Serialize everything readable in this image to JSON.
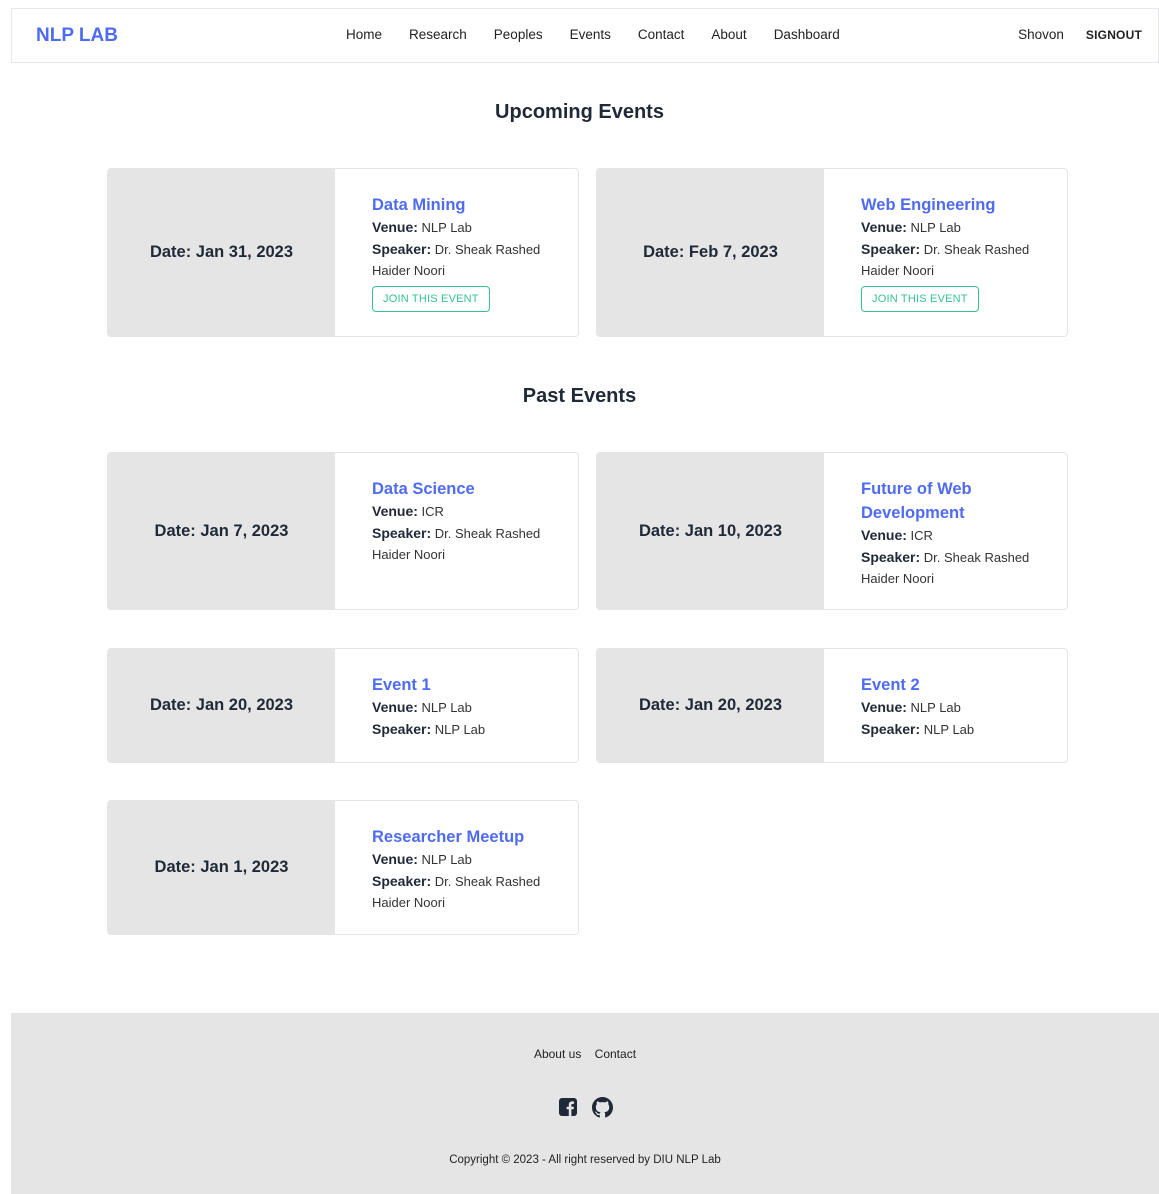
{
  "nav": {
    "brand": "NLP LAB",
    "links": [
      "Home",
      "Research",
      "Peoples",
      "Events",
      "Contact",
      "About",
      "Dashboard"
    ],
    "user": "Shovon",
    "signout": "SIGNOUT"
  },
  "upcoming": {
    "heading": "Upcoming Events",
    "events": [
      {
        "date": "Date: Jan 31, 2023",
        "title": "Data Mining",
        "venue": "NLP Lab",
        "speaker": "Dr. Sheak Rashed Haider Noori",
        "button": "JOIN THIS EVENT"
      },
      {
        "date": "Date: Feb 7, 2023",
        "title": "Web Engineering",
        "venue": "NLP Lab",
        "speaker": "Dr. Sheak Rashed Haider Noori",
        "button": "JOIN THIS EVENT"
      }
    ]
  },
  "past": {
    "heading": "Past Events",
    "events": [
      {
        "date": "Date: Jan 7, 2023",
        "title": "Data Science",
        "venue": "ICR",
        "speaker": "Dr. Sheak Rashed Haider Noori"
      },
      {
        "date": "Date: Jan 10, 2023",
        "title": "Future of Web Development",
        "venue": "ICR",
        "speaker": "Dr. Sheak Rashed Haider Noori"
      },
      {
        "date": "Date: Jan 20, 2023",
        "title": "Event 1",
        "venue": "NLP Lab",
        "speaker": "NLP Lab"
      },
      {
        "date": "Date: Jan 20, 2023",
        "title": "Event 2",
        "venue": "NLP Lab",
        "speaker": "NLP Lab"
      },
      {
        "date": "Date: Jan 1, 2023",
        "title": "Researcher Meetup",
        "venue": "NLP Lab",
        "speaker": "Dr. Sheak Rashed Haider Noori"
      }
    ]
  },
  "labels": {
    "venue": "Venue:",
    "speaker": "Speaker:"
  },
  "footer": {
    "links": [
      "About us",
      "Contact"
    ],
    "icons": [
      "facebook-icon",
      "github-icon"
    ],
    "copyright": "Copyright © 2023 - All right reserved by DIU NLP Lab"
  },
  "colors": {
    "accent": "#4f6bf0",
    "button": "#34c38f",
    "date_panel": "#e5e5e5",
    "footer": "#e5e5e5"
  }
}
